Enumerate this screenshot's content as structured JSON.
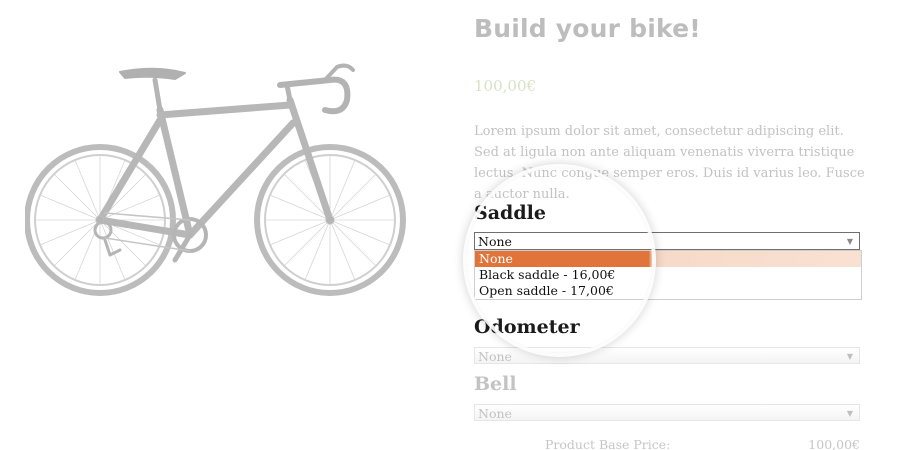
{
  "product": {
    "title": "Build your bike!",
    "price": "100,00€",
    "description": "Lorem ipsum dolor sit amet, consectetur adipiscing elit. Sed at ligula non ante aliquam venenatis viverra tristique lectus. Nunc congue semper eros. Duis id varius leo. Fusce a auctor nulla."
  },
  "options": {
    "saddle": {
      "label": "Saddle",
      "selected": "None",
      "choices": [
        "None",
        "Black saddle - 16,00€",
        "Open saddle - 17,00€"
      ]
    },
    "odometer": {
      "label": "Odometer",
      "selected": "None"
    },
    "bell": {
      "label": "Bell",
      "selected": "None"
    }
  },
  "summary": {
    "base_price_label": "Product Base Price:",
    "base_price_value": "100,00€"
  },
  "icons": {
    "product_image": "road-bike-image",
    "dropdown_arrow": "chevron-down-icon"
  },
  "colors": {
    "highlight": "#e0743a"
  }
}
